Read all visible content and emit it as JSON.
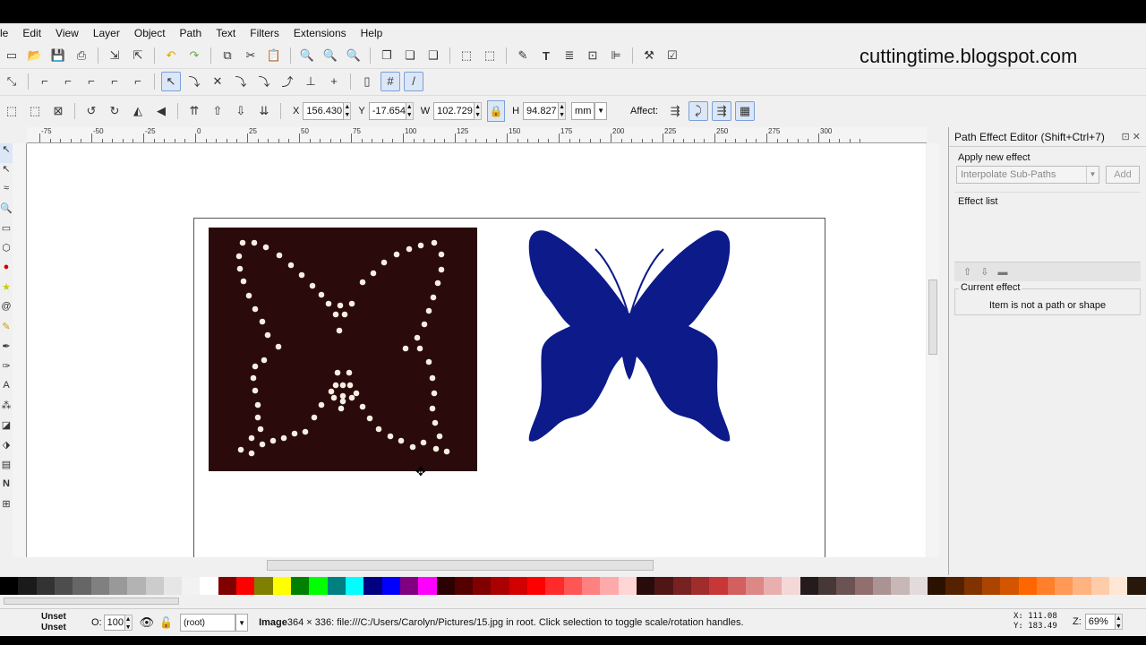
{
  "menu": [
    "File",
    "Edit",
    "View",
    "Layer",
    "Object",
    "Path",
    "Text",
    "Filters",
    "Extensions",
    "Help"
  ],
  "menu_visible": [
    "le",
    "Edit",
    "View",
    "Layer",
    "Object",
    "Path",
    "Text",
    "Filters",
    "Extensions",
    "Help"
  ],
  "overlay_text": "cuttingtime.blogspot.com",
  "select_toolbar": {
    "x_label": "X",
    "x_value": "156.430",
    "y_label": "Y",
    "y_value": "-17.654",
    "w_label": "W",
    "w_value": "102.729",
    "h_label": "H",
    "h_value": "94.827",
    "unit": "mm",
    "affect_label": "Affect:"
  },
  "ruler_labels": [
    "-75",
    "-50",
    "-25",
    "0",
    "25",
    "50",
    "75",
    "100",
    "125",
    "150",
    "175",
    "200",
    "225",
    "250",
    "275",
    "300"
  ],
  "panel": {
    "title": "Path Effect Editor (Shift+Ctrl+7)",
    "apply_label": "Apply new effect",
    "effect_combo": "Interpolate Sub-Paths",
    "add_button": "Add",
    "effect_list_label": "Effect list",
    "current_effect_label": "Current effect",
    "current_effect_text": "Item is not a path or shape"
  },
  "palette": [
    "#000000",
    "#1a1a1a",
    "#333333",
    "#4d4d4d",
    "#666666",
    "#808080",
    "#999999",
    "#b3b3b3",
    "#cccccc",
    "#e6e6e6",
    "#f2f2f2",
    "#ffffff",
    "#800000",
    "#ff0000",
    "#808000",
    "#ffff00",
    "#008000",
    "#00ff00",
    "#008080",
    "#00ffff",
    "#000080",
    "#0000ff",
    "#800080",
    "#ff00ff",
    "#2b0000",
    "#550000",
    "#800000",
    "#aa0000",
    "#d40000",
    "#ff0000",
    "#ff2a2a",
    "#ff5555",
    "#ff8080",
    "#ffaaaa",
    "#ffd5d5",
    "#280b0b",
    "#501616",
    "#782121",
    "#a02c2c",
    "#c83737",
    "#d35f5f",
    "#de8787",
    "#e9afaf",
    "#f4d7d7",
    "#241c1c",
    "#483737",
    "#6c5353",
    "#916f6f",
    "#ac9393",
    "#c8b7b7",
    "#e3dbdb",
    "#2b1100",
    "#552200",
    "#803300",
    "#aa4400",
    "#d45500",
    "#ff6600",
    "#ff7f2a",
    "#ff9955",
    "#ffb380",
    "#ffccaa",
    "#ffe6d5",
    "#28170b"
  ],
  "status": {
    "fill_label": "Unset",
    "stroke_label": "Unset",
    "opacity_label": "O:",
    "opacity_value": "100",
    "layer": "(root)",
    "message_bold": "Image",
    "message": " 364 × 336: file:///C:/Users/Carolyn/Pictures/15.jpg in root. Click selection to toggle scale/rotation handles.",
    "x_coord": "X: 111.08",
    "y_coord": "Y: 183.49",
    "zoom_label": "Z:",
    "zoom_value": "69%"
  },
  "colors": {
    "image_bg": "#2a0a0a",
    "dots": "#f4efe2",
    "butterfly": "#0c1a8a"
  }
}
